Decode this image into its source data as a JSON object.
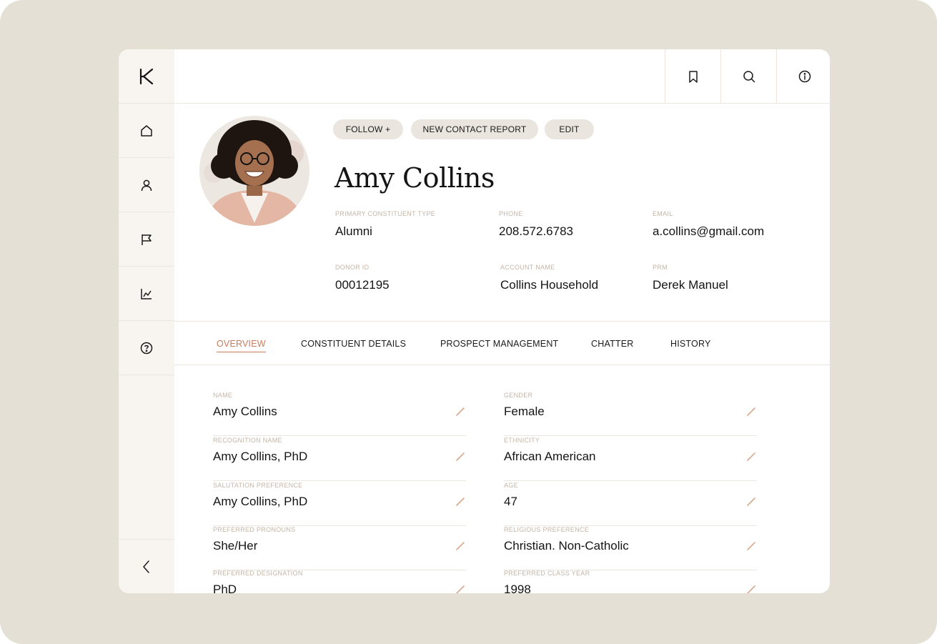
{
  "colors": {
    "accent": "#c97c5d",
    "label": "#c4b5a7",
    "pill": "#ebe5df",
    "sidebar": "#f8f5f1",
    "backdrop": "#e4e0d5"
  },
  "sidebar": {
    "logo_icon": "k-logo",
    "items": [
      {
        "icon": "home-icon"
      },
      {
        "icon": "user-icon"
      },
      {
        "icon": "flag-icon"
      },
      {
        "icon": "chart-icon"
      },
      {
        "icon": "help-icon"
      }
    ],
    "collapse_icon": "chevron-left-icon"
  },
  "topbar": {
    "icons": [
      "bookmark-icon",
      "search-icon",
      "info-icon"
    ]
  },
  "profile": {
    "actions": {
      "follow": "FOLLOW +",
      "new_contact_report": "NEW CONTACT REPORT",
      "edit": "EDIT"
    },
    "name": "Amy Collins",
    "meta": {
      "primary_type_label": "PRIMARY CONSTITUENT TYPE",
      "primary_type_value": "Alumni",
      "phone_label": "PHONE",
      "phone_value": "208.572.6783",
      "email_label": "EMAIL",
      "email_value": "a.collins@gmail.com",
      "donor_id_label": "DONOR ID",
      "donor_id_value": "00012195",
      "account_label": "ACCOUNT NAME",
      "account_value": "Collins Household",
      "prm_label": "PRM",
      "prm_value": "Derek Manuel"
    }
  },
  "tabs": [
    {
      "label": "OVERVIEW",
      "active": true
    },
    {
      "label": "CONSTITUENT DETAILS",
      "active": false
    },
    {
      "label": "PROSPECT MANAGEMENT",
      "active": false
    },
    {
      "label": "CHATTER",
      "active": false
    },
    {
      "label": "HISTORY",
      "active": false
    }
  ],
  "fields": {
    "left": [
      {
        "label": "NAME",
        "value": "Amy Collins"
      },
      {
        "label": "RECOGNITION NAME",
        "value": "Amy Collins, PhD"
      },
      {
        "label": "SALUTATION PREFERENCE",
        "value": "Amy Collins, PhD"
      },
      {
        "label": "PREFERRED PRONOUNS",
        "value": "She/Her"
      },
      {
        "label": "PREFERRED DESIGNATION",
        "value": "PhD"
      }
    ],
    "right": [
      {
        "label": "GENDER",
        "value": "Female"
      },
      {
        "label": "ETHNICITY",
        "value": "African American"
      },
      {
        "label": "AGE",
        "value": "47"
      },
      {
        "label": "RELIGIOUS PREFERENCE",
        "value": "Christian. Non-Catholic"
      },
      {
        "label": "PREFERRED CLASS YEAR",
        "value": "1998"
      }
    ]
  }
}
